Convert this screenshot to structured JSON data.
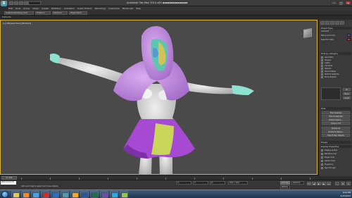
{
  "window": {
    "title": "Autodesk 3ds Max 2014 x64 ▪▪▪▪▪▪▪▪▪▪▪▪▪▪▪",
    "logo_letter": "S",
    "minimize": "–",
    "maximize": "□",
    "close": "✕"
  },
  "menu": {
    "items": [
      "Edit",
      "Tools",
      "Group",
      "Views",
      "Create",
      "Modifiers",
      "Animation",
      "Graph Editors",
      "Rendering",
      "Customize",
      "MAXScript",
      "Help"
    ]
  },
  "ribbon": {
    "tabs": [
      "Graphite Modeling Tools",
      "Freeform",
      "Selection",
      "Object Paint"
    ],
    "sub_label": "Defaults"
  },
  "viewport": {
    "label": "[+] [Perspective] [Shaded]"
  },
  "command_panel": {
    "rollout_name": "Object Type",
    "autogrid": "AutoGrid",
    "name_label": "Name and Color",
    "selection_sets": "Selection Sets",
    "category_head": "Hide by Category",
    "categories": [
      "Geometry",
      "Shapes",
      "Lights",
      "Cameras",
      "Helpers",
      "Space Warps",
      "Particle Systems",
      "Bone Objects"
    ],
    "list_head": "Hide",
    "buttons": [
      "Hide Selected",
      "Hide Unselected",
      "Hide by Name...",
      "Hide by Hit",
      "Unhide All",
      "Unhide by Name...",
      "Hide Frozen Objects"
    ],
    "freeze_head": "Freeze",
    "display_head": "Display Properties",
    "display_items": [
      "Display as Box",
      "Backface Cull",
      "Edges Only",
      "Vertex Ticks",
      "Trajectory",
      "See-Through"
    ],
    "all": "All",
    "none": "None",
    "invert": "Invert"
  },
  "timeline": {
    "slider_text": "0 / 100",
    "ticks": [
      "0",
      "10",
      "20",
      "30",
      "40",
      "50",
      "60",
      "70",
      "80",
      "90",
      "100"
    ]
  },
  "status": {
    "script_field": "Welcome to M",
    "text": "Click and drag to select and move objects",
    "x_label": "X:",
    "y_label": "Y:",
    "z_label": "Z:",
    "grid": "Grid = 10.0",
    "auto_key": "Auto Key",
    "set_key": "Set Key",
    "selected": "Selected"
  },
  "taskbar": {
    "apps": [
      {
        "name": "explorer-app",
        "color": "#e8c75a"
      },
      {
        "name": "media-player-app",
        "color": "#f08a2a"
      },
      {
        "name": "chrome-app",
        "color": "#4aa3e0"
      },
      {
        "name": "acrobat-app",
        "color": "#d12a2a"
      },
      {
        "name": "photoshop-app",
        "color": "#2d6fb8"
      },
      {
        "name": "max-app",
        "color": "#4e9aa8"
      },
      {
        "name": "illustrator-app",
        "color": "#f5a623"
      },
      {
        "name": "word-app",
        "color": "#2b5797"
      },
      {
        "name": "excel-app",
        "color": "#1e7145"
      },
      {
        "name": "premiere-app",
        "color": "#6a4ea0"
      },
      {
        "name": "skype-app",
        "color": "#2ca7e0"
      },
      {
        "name": "paint-app",
        "color": "#9bc24a"
      }
    ],
    "time": "9:24 PM",
    "date": "4/15/2014"
  },
  "colors": {
    "viewport_bg": "#4a4a4a",
    "hood": "#c58ee6",
    "body": "#d7d7d7",
    "skirt": "#a64ad4",
    "skirt_panel": "#c9d65a",
    "hands": "#8ee3d0"
  }
}
